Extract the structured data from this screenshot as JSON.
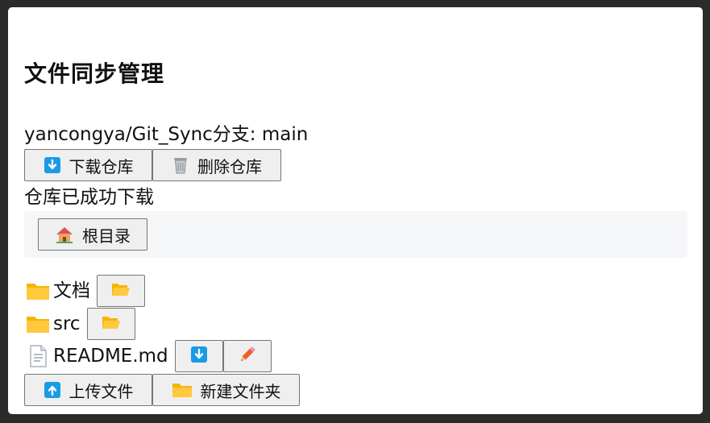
{
  "header": {
    "title": "文件同步管理"
  },
  "repo": {
    "name": "yancongya/Git_Sync",
    "branch_label": "分支: ",
    "branch": "main"
  },
  "actions": {
    "download_label": "下载仓库",
    "delete_label": "删除仓库"
  },
  "status_text": "仓库已成功下载",
  "breadcrumb": {
    "root_label": "根目录"
  },
  "files": [
    {
      "name": "文档",
      "type": "folder"
    },
    {
      "name": "src",
      "type": "folder"
    },
    {
      "name": "README.md",
      "type": "file"
    }
  ],
  "bottom": {
    "upload_label": "上传文件",
    "new_folder_label": "新建文件夹"
  },
  "colors": {
    "accent_blue": "#1a9be6",
    "folder_yellow": "#ffc83d",
    "pencil": "#f25c2a"
  }
}
